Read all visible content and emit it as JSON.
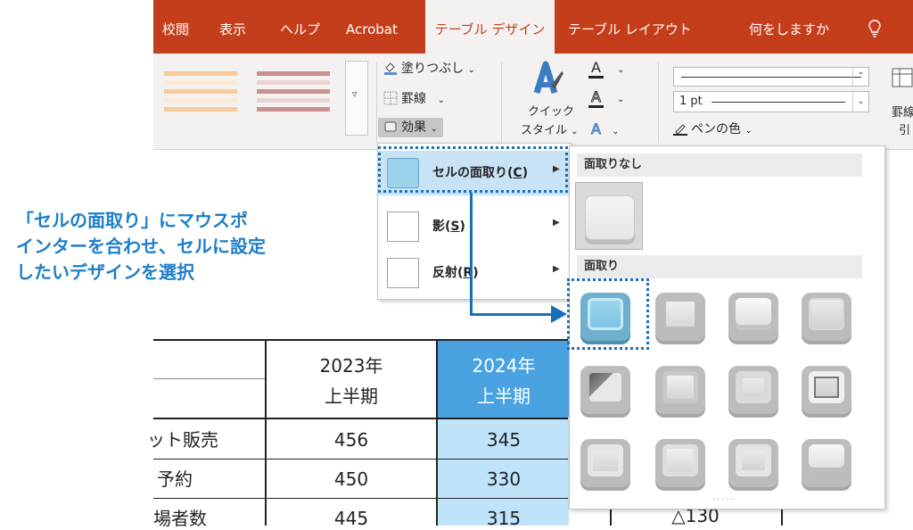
{
  "ribbon": {
    "tabs": [
      "校閲",
      "表示",
      "ヘルプ",
      "Acrobat",
      "テーブル デザイン",
      "テーブル レイアウト",
      "何をしますか"
    ],
    "active_tab": "テーブル デザイン",
    "shading_label": "塗りつぶし",
    "borders_label": "罫線",
    "effects_label": "効果",
    "quick_styles_line1": "クイック",
    "quick_styles_line2": "スタイル",
    "pen_weight": "1 pt",
    "pen_color_label": "ペンの色",
    "draw_table_line1": "罫線",
    "draw_table_line2": "引",
    "text_fill_glyph": "A",
    "text_outline_glyph": "A",
    "text_effects_glyph": "A"
  },
  "effects_menu": {
    "items": [
      {
        "label": "セルの面取り(",
        "accel": "C",
        "suffix": ")"
      },
      {
        "label": "影(",
        "accel": "S",
        "suffix": ")"
      },
      {
        "label": "反射(",
        "accel": "R",
        "suffix": ")"
      }
    ]
  },
  "bevel_gallery": {
    "section_none": "面取りなし",
    "section_bevel": "面取り"
  },
  "annotation": {
    "line1": "「セルの面取り」にマウスポ",
    "line2": "インターを合わせ、セルに設定",
    "line3": "したいデザインを選択"
  },
  "table": {
    "header_col1": [
      "2023年",
      "上半期"
    ],
    "header_col2": [
      "2024年",
      "上半期"
    ],
    "rows": [
      {
        "label": "ット販売",
        "v2023": "456",
        "v2024": "345"
      },
      {
        "label": "予約",
        "v2023": "450",
        "v2024": "330"
      },
      {
        "label": "場者数",
        "v2023": "445",
        "v2024": "315",
        "extra": "△130"
      }
    ]
  },
  "colors": {
    "ribbon_tab_bg": "#c43e1c",
    "ribbon_bg": "#f3f2f1",
    "annotation": "#1e7fc8",
    "highlight_cell": "#bfe3f8",
    "header_cell": "#4aa3e0"
  }
}
